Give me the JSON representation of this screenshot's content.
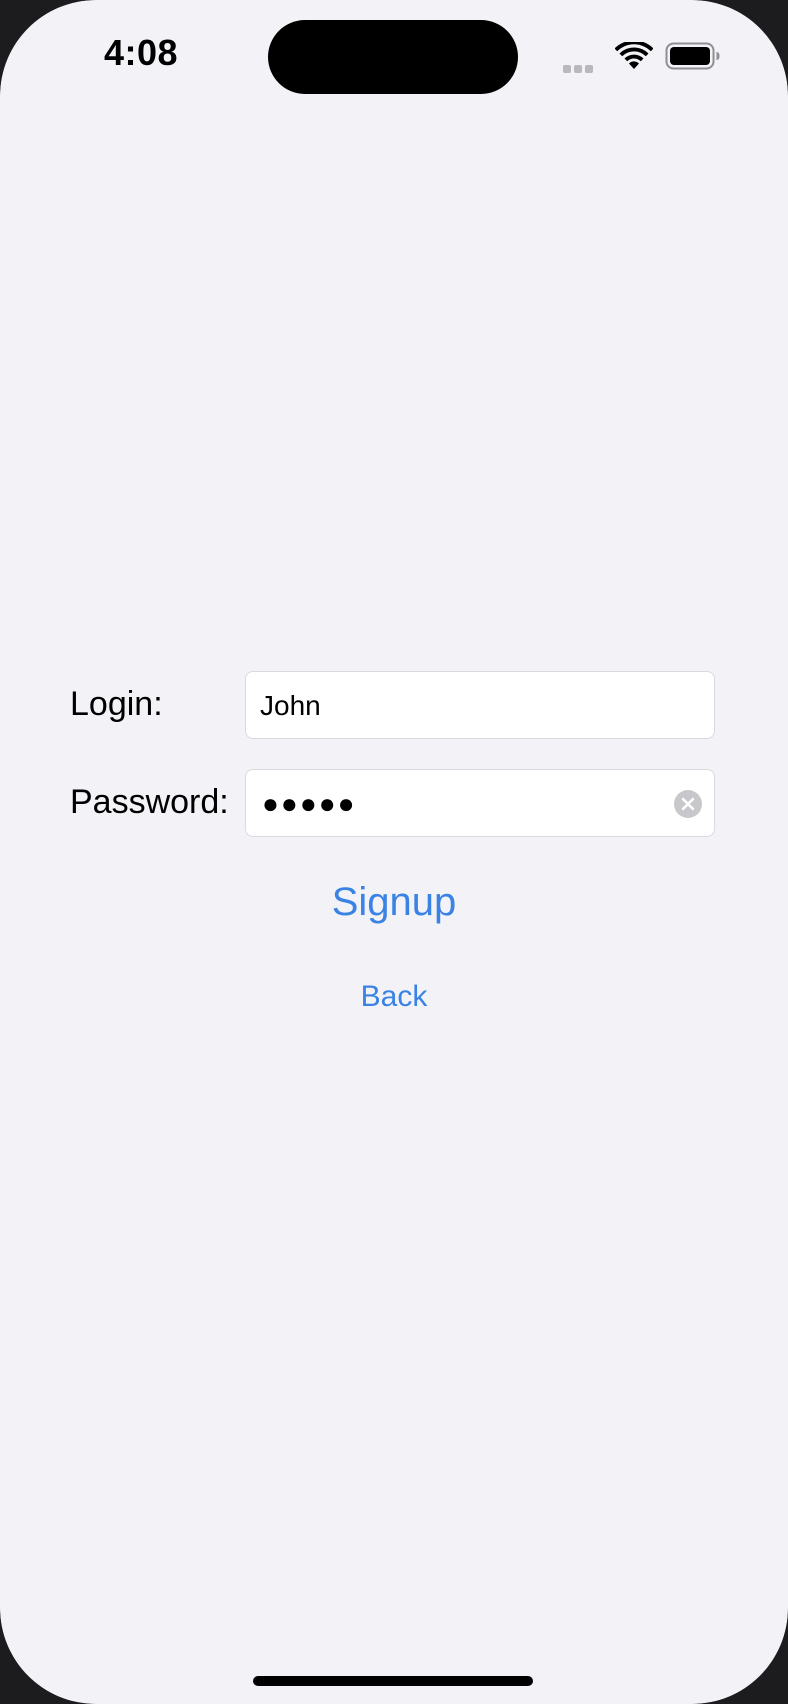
{
  "status_bar": {
    "time": "4:08"
  },
  "form": {
    "login_label": "Login:",
    "login_value": "John",
    "password_label": "Password:",
    "password_masked": "●●●●●"
  },
  "actions": {
    "signup_label": "Signup",
    "back_label": "Back"
  },
  "colors": {
    "accent": "#3a82e4",
    "background": "#f2f2f7",
    "field_background": "#ffffff"
  },
  "icons": {
    "wifi": "wifi-icon",
    "battery": "battery-icon",
    "signal": "cellular-signal-icon",
    "clear": "clear-text-icon"
  }
}
